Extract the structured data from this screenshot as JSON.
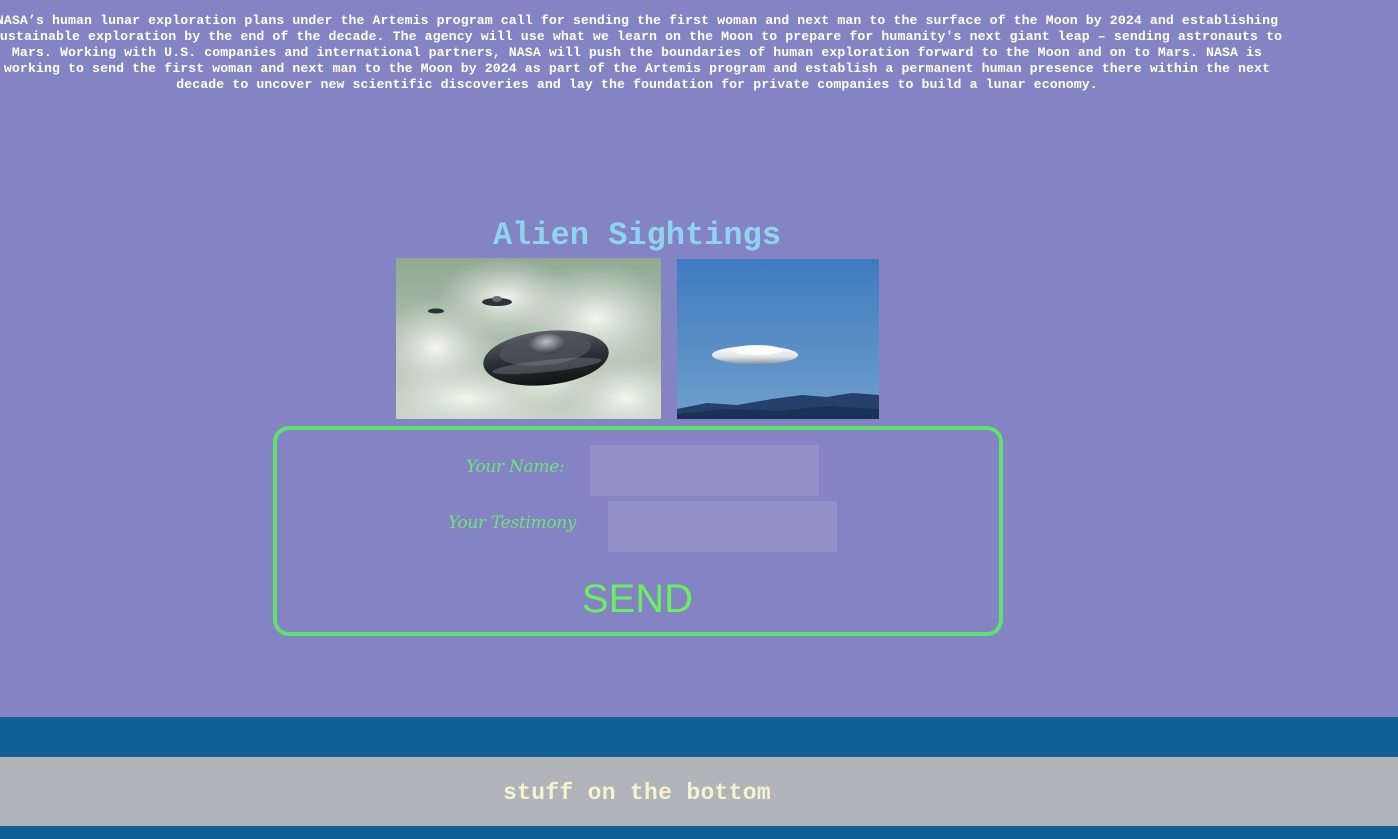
{
  "intro": {
    "text": "NASA’s human lunar exploration plans under the Artemis program call for sending the first woman and next man to the surface of the Moon by 2024 and establishing sustainable exploration by the end of the decade. The agency will use what we learn on the Moon to prepare for humanity's next giant leap – sending astronauts to Mars. Working with U.S. companies and international partners, NASA will push the boundaries of human exploration forward to the Moon and on to Mars. NASA is working to send the first woman and next man to the Moon by 2024 as part of the Artemis program and establish a permanent human presence there within the next decade to uncover new scientific discoveries and lay the foundation for private companies to build a lunar economy."
  },
  "main": {
    "title": "Alien Sightings",
    "images": [
      {
        "subject": "ufo-fleet-over-clouds-photo"
      },
      {
        "subject": "lenticular-cloud-over-mountains-photo"
      }
    ]
  },
  "form": {
    "name_label": "Your Name:",
    "name_value": "",
    "testimony_label": "Your Testimony",
    "testimony_value": "",
    "send_label": "SEND"
  },
  "footer": {
    "text": "stuff on the bottom"
  },
  "colors": {
    "page_background": "#8483c4",
    "title": "#8fd3ee",
    "form_accent": "#5de36d",
    "send_text": "#69f05a",
    "band": "#125f95",
    "footer_background": "#b1b5b9",
    "footer_text": "#f5f3d0"
  }
}
